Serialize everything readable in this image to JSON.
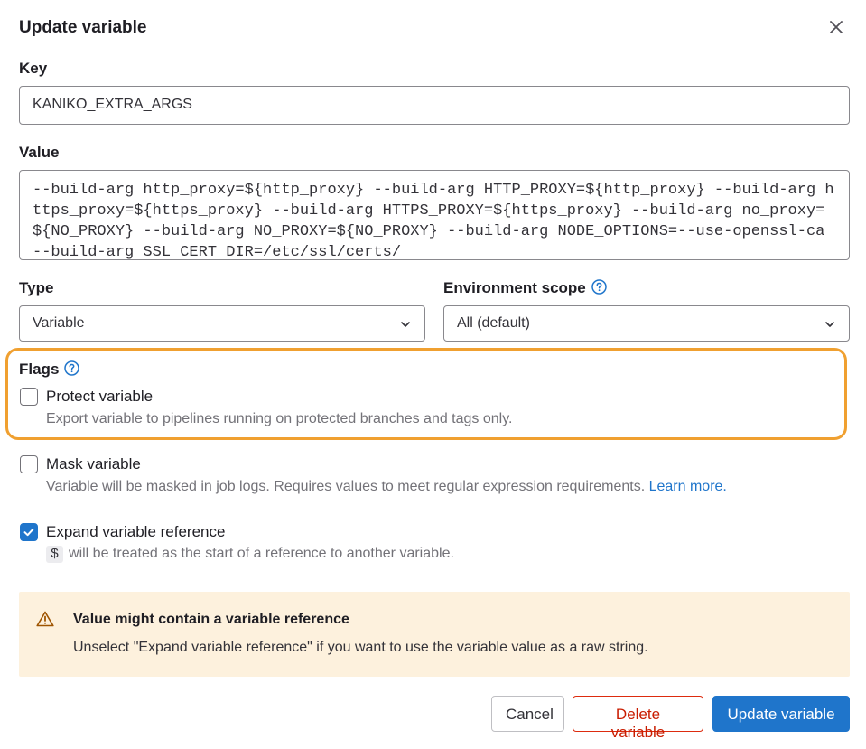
{
  "modal": {
    "title": "Update variable",
    "close_icon": "close-icon"
  },
  "key": {
    "label": "Key",
    "value": "KANIKO_EXTRA_ARGS"
  },
  "value": {
    "label": "Value",
    "text": "--build-arg http_proxy=${http_proxy} --build-arg HTTP_PROXY=${http_proxy} --build-arg https_proxy=${https_proxy} --build-arg HTTPS_PROXY=${https_proxy} --build-arg no_proxy=${NO_PROXY} --build-arg NO_PROXY=${NO_PROXY} --build-arg NODE_OPTIONS=--use-openssl-ca --build-arg SSL_CERT_DIR=/etc/ssl/certs/"
  },
  "type": {
    "label": "Type",
    "selected": "Variable"
  },
  "environment_scope": {
    "label": "Environment scope",
    "selected": "All (default)"
  },
  "flags": {
    "label": "Flags",
    "protect": {
      "label": "Protect variable",
      "help": "Export variable to pipelines running on protected branches and tags only.",
      "checked": false
    },
    "mask": {
      "label": "Mask variable",
      "help": "Variable will be masked in job logs. Requires values to meet regular expression requirements.",
      "link": "Learn more.",
      "checked": false
    },
    "expand": {
      "label": "Expand variable reference",
      "code": "$",
      "help": "will be treated as the start of a reference to another variable.",
      "checked": true
    }
  },
  "alert": {
    "icon": "warning-icon",
    "title": "Value might contain a variable reference",
    "body": "Unselect \"Expand variable reference\" if you want to use the variable value as a raw string."
  },
  "buttons": {
    "cancel": "Cancel",
    "delete": "Delete variable",
    "update": "Update variable"
  },
  "colors": {
    "primary": "#1f75cb",
    "danger": "#dd2b0e",
    "highlight": "#f0a030",
    "alert_bg": "#fdf1dd"
  }
}
